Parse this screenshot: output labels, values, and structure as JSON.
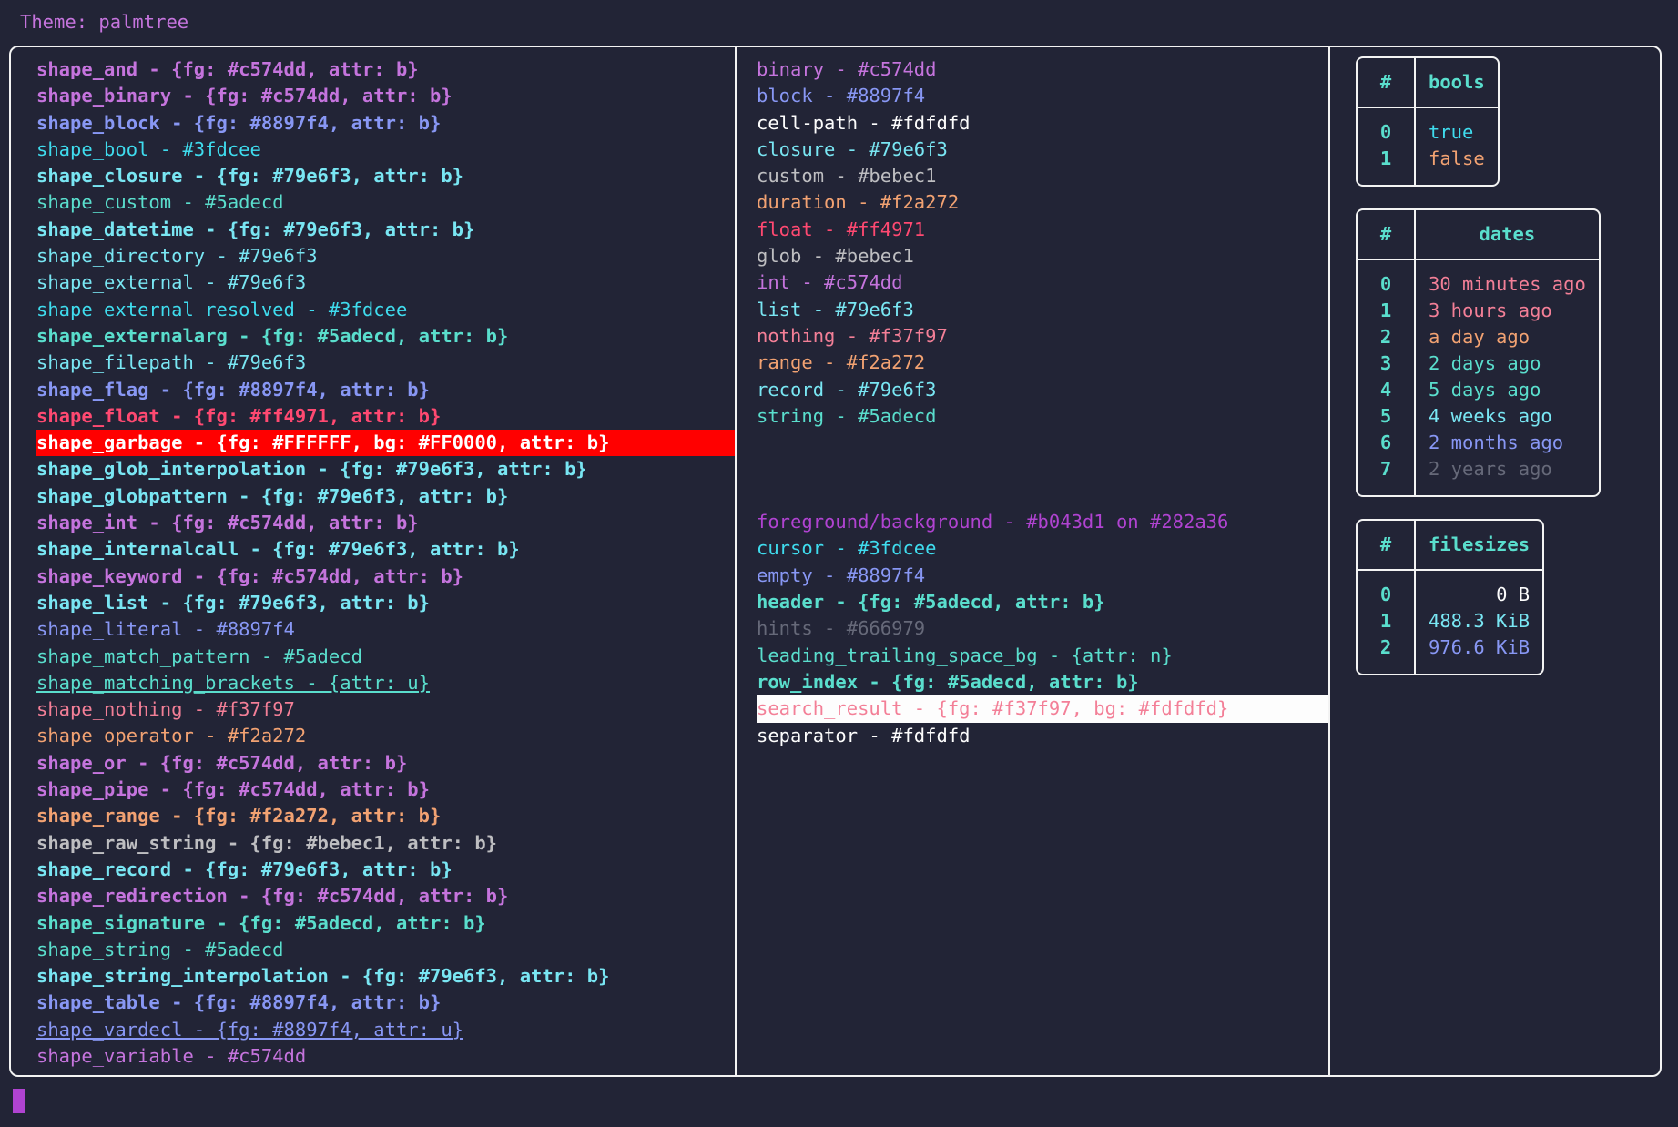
{
  "header": {
    "label": "Theme: ",
    "theme_name": "palmtree",
    "full": "Theme: palmtree"
  },
  "colors": {
    "background": "#222436",
    "border": "#f3f3f3",
    "purple": "#c574dd",
    "blue": "#8897f4",
    "cyan": "#3fdcee",
    "light_cyan": "#79e6f3",
    "teal": "#5adecd",
    "red": "#ff4971",
    "pink": "#f37f97",
    "orange": "#f2a272",
    "grey": "#bebec1",
    "white": "#fdfdfd",
    "dim": "#666979",
    "magenta": "#b043d1",
    "garbage_fg": "#FFFFFF",
    "garbage_bg": "#FF0000",
    "search_fg": "#f37f97",
    "search_bg": "#fdfdfd"
  },
  "shapes": [
    {
      "text": "shape_and - {fg: #c574dd, attr: b}",
      "cls": "c-purple b"
    },
    {
      "text": "shape_binary - {fg: #c574dd, attr: b}",
      "cls": "c-purple b"
    },
    {
      "text": "shape_block - {fg: #8897f4, attr: b}",
      "cls": "c-blue b"
    },
    {
      "text": "shape_bool - #3fdcee",
      "cls": "c-cyan"
    },
    {
      "text": "shape_closure - {fg: #79e6f3, attr: b}",
      "cls": "c-lcyan b"
    },
    {
      "text": "shape_custom - #5adecd",
      "cls": "c-teal"
    },
    {
      "text": "shape_datetime - {fg: #79e6f3, attr: b}",
      "cls": "c-lcyan b"
    },
    {
      "text": "shape_directory - #79e6f3",
      "cls": "c-lcyan"
    },
    {
      "text": "shape_external - #79e6f3",
      "cls": "c-lcyan"
    },
    {
      "text": "shape_external_resolved - #3fdcee",
      "cls": "c-cyan"
    },
    {
      "text": "shape_externalarg - {fg: #5adecd, attr: b}",
      "cls": "c-teal b"
    },
    {
      "text": "shape_filepath - #79e6f3",
      "cls": "c-lcyan"
    },
    {
      "text": "shape_flag - {fg: #8897f4, attr: b}",
      "cls": "c-blue b"
    },
    {
      "text": "shape_float - {fg: #ff4971, attr: b}",
      "cls": "c-red b"
    },
    {
      "text": "shape_garbage - {fg: #FFFFFF, bg: #FF0000, attr: b}",
      "cls": "hl-garbage"
    },
    {
      "text": "shape_glob_interpolation - {fg: #79e6f3, attr: b}",
      "cls": "c-lcyan b"
    },
    {
      "text": "shape_globpattern - {fg: #79e6f3, attr: b}",
      "cls": "c-lcyan b"
    },
    {
      "text": "shape_int - {fg: #c574dd, attr: b}",
      "cls": "c-purple b"
    },
    {
      "text": "shape_internalcall - {fg: #79e6f3, attr: b}",
      "cls": "c-lcyan b"
    },
    {
      "text": "shape_keyword - {fg: #c574dd, attr: b}",
      "cls": "c-purple b"
    },
    {
      "text": "shape_list - {fg: #79e6f3, attr: b}",
      "cls": "c-lcyan b"
    },
    {
      "text": "shape_literal - #8897f4",
      "cls": "c-blue"
    },
    {
      "text": "shape_match_pattern - #5adecd",
      "cls": "c-teal"
    },
    {
      "text": "shape_matching_brackets - {attr: u}",
      "cls": "c-teal u"
    },
    {
      "text": "shape_nothing - #f37f97",
      "cls": "c-pink"
    },
    {
      "text": "shape_operator - #f2a272",
      "cls": "c-orange"
    },
    {
      "text": "shape_or - {fg: #c574dd, attr: b}",
      "cls": "c-purple b"
    },
    {
      "text": "shape_pipe - {fg: #c574dd, attr: b}",
      "cls": "c-purple b"
    },
    {
      "text": "shape_range - {fg: #f2a272, attr: b}",
      "cls": "c-orange b"
    },
    {
      "text": "shape_raw_string - {fg: #bebec1, attr: b}",
      "cls": "c-grey b"
    },
    {
      "text": "shape_record - {fg: #79e6f3, attr: b}",
      "cls": "c-lcyan b"
    },
    {
      "text": "shape_redirection - {fg: #c574dd, attr: b}",
      "cls": "c-purple b"
    },
    {
      "text": "shape_signature - {fg: #5adecd, attr: b}",
      "cls": "c-teal b"
    },
    {
      "text": "shape_string - #5adecd",
      "cls": "c-teal"
    },
    {
      "text": "shape_string_interpolation - {fg: #79e6f3, attr: b}",
      "cls": "c-lcyan b"
    },
    {
      "text": "shape_table - {fg: #8897f4, attr: b}",
      "cls": "c-blue b"
    },
    {
      "text": "shape_vardecl - {fg: #8897f4, attr: u}",
      "cls": "c-blue u"
    },
    {
      "text": "shape_variable - #c574dd",
      "cls": "c-purple"
    }
  ],
  "types": [
    {
      "text": "binary - #c574dd",
      "cls": "c-purple"
    },
    {
      "text": "block - #8897f4",
      "cls": "c-blue"
    },
    {
      "text": "cell-path - #fdfdfd",
      "cls": "c-white"
    },
    {
      "text": "closure - #79e6f3",
      "cls": "c-lcyan"
    },
    {
      "text": "custom - #bebec1",
      "cls": "c-grey"
    },
    {
      "text": "duration - #f2a272",
      "cls": "c-orange"
    },
    {
      "text": "float - #ff4971",
      "cls": "c-red"
    },
    {
      "text": "glob - #bebec1",
      "cls": "c-grey"
    },
    {
      "text": "int - #c574dd",
      "cls": "c-purple"
    },
    {
      "text": "list - #79e6f3",
      "cls": "c-lcyan"
    },
    {
      "text": "nothing - #f37f97",
      "cls": "c-pink"
    },
    {
      "text": "range - #f2a272",
      "cls": "c-orange"
    },
    {
      "text": "record - #79e6f3",
      "cls": "c-lcyan"
    },
    {
      "text": "string - #5adecd",
      "cls": "c-teal"
    }
  ],
  "ui_elements": [
    {
      "text": "foreground/background - #b043d1 on #282a36",
      "cls": "c-magenta"
    },
    {
      "text": "cursor - #3fdcee",
      "cls": "c-cyan"
    },
    {
      "text": "empty - #8897f4",
      "cls": "c-blue"
    },
    {
      "text": "header - {fg: #5adecd, attr: b}",
      "cls": "c-teal b"
    },
    {
      "text": "hints - #666979",
      "cls": "c-dim"
    },
    {
      "text": "leading_trailing_space_bg - {attr: n}",
      "cls": "c-teal"
    },
    {
      "text": "row_index - {fg: #5adecd, attr: b}",
      "cls": "c-teal b"
    },
    {
      "text": "search_result - {fg: #f37f97, bg: #fdfdfd}",
      "cls": "hl-search"
    },
    {
      "text": "separator - #fdfdfd",
      "cls": "c-white"
    }
  ],
  "tables": [
    {
      "name": "bools",
      "index_header": "#",
      "value_header": "bools",
      "align": "left",
      "rows": [
        {
          "index": "0",
          "value": "true",
          "cls": "c-cyan"
        },
        {
          "index": "1",
          "value": "false",
          "cls": "c-orange"
        }
      ]
    },
    {
      "name": "dates",
      "index_header": "#",
      "value_header": "dates",
      "align": "left",
      "rows": [
        {
          "index": "0",
          "value": "30 minutes ago",
          "cls": "c-pink b"
        },
        {
          "index": "1",
          "value": "3 hours ago",
          "cls": "c-pink"
        },
        {
          "index": "2",
          "value": "a day ago",
          "cls": "c-orange"
        },
        {
          "index": "3",
          "value": "2 days ago",
          "cls": "c-teal"
        },
        {
          "index": "4",
          "value": "5 days ago",
          "cls": "c-teal b"
        },
        {
          "index": "5",
          "value": "4 weeks ago",
          "cls": "c-lcyan"
        },
        {
          "index": "6",
          "value": "2 months ago",
          "cls": "c-blue"
        },
        {
          "index": "7",
          "value": "2 years ago",
          "cls": "c-dim"
        }
      ]
    },
    {
      "name": "filesizes",
      "index_header": "#",
      "value_header": "filesizes",
      "align": "right",
      "rows": [
        {
          "index": "0",
          "value": "0 B",
          "cls": "c-white"
        },
        {
          "index": "1",
          "value": "488.3 KiB",
          "cls": "c-lcyan"
        },
        {
          "index": "2",
          "value": "976.6 KiB",
          "cls": "c-blue"
        }
      ]
    }
  ]
}
